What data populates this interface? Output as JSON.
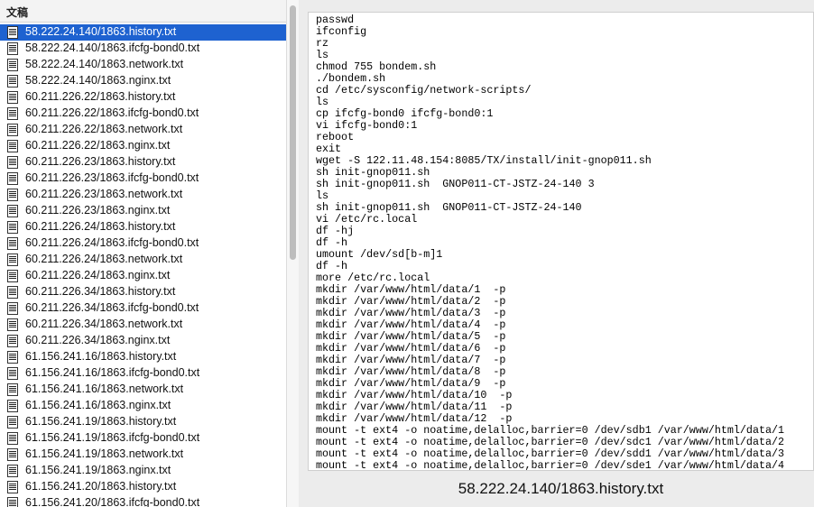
{
  "sidebar": {
    "header": "文稿",
    "selected_index": 0,
    "items": [
      "58.222.24.140/1863.history.txt",
      "58.222.24.140/1863.ifcfg-bond0.txt",
      "58.222.24.140/1863.network.txt",
      "58.222.24.140/1863.nginx.txt",
      "60.211.226.22/1863.history.txt",
      "60.211.226.22/1863.ifcfg-bond0.txt",
      "60.211.226.22/1863.network.txt",
      "60.211.226.22/1863.nginx.txt",
      "60.211.226.23/1863.history.txt",
      "60.211.226.23/1863.ifcfg-bond0.txt",
      "60.211.226.23/1863.network.txt",
      "60.211.226.23/1863.nginx.txt",
      "60.211.226.24/1863.history.txt",
      "60.211.226.24/1863.ifcfg-bond0.txt",
      "60.211.226.24/1863.network.txt",
      "60.211.226.24/1863.nginx.txt",
      "60.211.226.34/1863.history.txt",
      "60.211.226.34/1863.ifcfg-bond0.txt",
      "60.211.226.34/1863.network.txt",
      "60.211.226.34/1863.nginx.txt",
      "61.156.241.16/1863.history.txt",
      "61.156.241.16/1863.ifcfg-bond0.txt",
      "61.156.241.16/1863.network.txt",
      "61.156.241.16/1863.nginx.txt",
      "61.156.241.19/1863.history.txt",
      "61.156.241.19/1863.ifcfg-bond0.txt",
      "61.156.241.19/1863.network.txt",
      "61.156.241.19/1863.nginx.txt",
      "61.156.241.20/1863.history.txt",
      "61.156.241.20/1863.ifcfg-bond0.txt"
    ]
  },
  "preview": {
    "filename": "58.222.24.140/1863.history.txt",
    "lines": [
      "passwd",
      "ifconfig",
      "rz",
      "ls",
      "chmod 755 bondem.sh",
      "./bondem.sh",
      "cd /etc/sysconfig/network-scripts/",
      "ls",
      "cp ifcfg-bond0 ifcfg-bond0:1",
      "vi ifcfg-bond0:1",
      "reboot",
      "exit",
      "wget -S 122.11.48.154:8085/TX/install/init-gnop011.sh",
      "sh init-gnop011.sh",
      "sh init-gnop011.sh  GNOP011-CT-JSTZ-24-140 3",
      "ls",
      "sh init-gnop011.sh  GNOP011-CT-JSTZ-24-140",
      "vi /etc/rc.local",
      "df -hj",
      "df -h",
      "umount /dev/sd[b-m]1",
      "df -h",
      "more /etc/rc.local",
      "mkdir /var/www/html/data/1  -p",
      "mkdir /var/www/html/data/2  -p",
      "mkdir /var/www/html/data/3  -p",
      "mkdir /var/www/html/data/4  -p",
      "mkdir /var/www/html/data/5  -p",
      "mkdir /var/www/html/data/6  -p",
      "mkdir /var/www/html/data/7  -p",
      "mkdir /var/www/html/data/8  -p",
      "mkdir /var/www/html/data/9  -p",
      "mkdir /var/www/html/data/10  -p",
      "mkdir /var/www/html/data/11  -p",
      "mkdir /var/www/html/data/12  -p",
      "mount -t ext4 -o noatime,delalloc,barrier=0 /dev/sdb1 /var/www/html/data/1",
      "mount -t ext4 -o noatime,delalloc,barrier=0 /dev/sdc1 /var/www/html/data/2",
      "mount -t ext4 -o noatime,delalloc,barrier=0 /dev/sdd1 /var/www/html/data/3",
      "mount -t ext4 -o noatime,delalloc,barrier=0 /dev/sde1 /var/www/html/data/4"
    ]
  },
  "colors": {
    "selection": "#1e62d0",
    "pane_bg": "#ffffff",
    "window_bg": "#ececec"
  },
  "icons": {
    "file": "document-icon"
  }
}
